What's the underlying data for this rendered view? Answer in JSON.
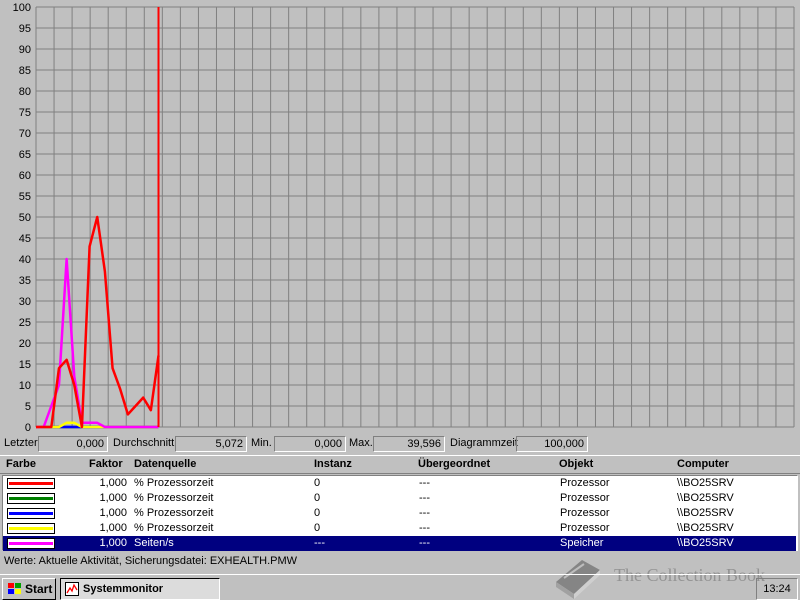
{
  "app": {
    "window_title": "Systemmonitor"
  },
  "chart_data": {
    "type": "line",
    "yticks": [
      "100",
      "95",
      "90",
      "85",
      "80",
      "75",
      "70",
      "65",
      "60",
      "55",
      "50",
      "45",
      "40",
      "35",
      "30",
      "25",
      "20",
      "15",
      "10",
      "5",
      "0"
    ],
    "ylim": [
      0,
      100
    ],
    "x_samples": 100,
    "cursor_sample": 16,
    "series": [
      {
        "color": "#ff0000",
        "values": [
          0,
          0,
          0,
          14,
          16,
          10,
          0,
          43,
          50,
          37,
          14,
          9,
          3,
          5,
          7,
          4,
          17
        ]
      },
      {
        "color": "#ff00ff",
        "values": [
          0,
          0,
          5,
          10,
          40,
          12,
          1,
          1,
          1,
          0,
          0,
          0,
          0,
          0,
          0,
          0,
          0
        ]
      },
      {
        "color": "#ffff00",
        "values": [
          0,
          0,
          0,
          0,
          1,
          1,
          0,
          0,
          0,
          0,
          0,
          0,
          0,
          0,
          0,
          0,
          0
        ]
      },
      {
        "color": "#0000ff",
        "values": [
          0,
          0,
          0,
          0,
          0,
          0,
          0,
          0,
          0,
          0,
          0,
          0,
          0,
          0,
          0,
          0,
          0
        ]
      },
      {
        "color": "#008000",
        "values": [
          0,
          0,
          0,
          0,
          0,
          0,
          0,
          0,
          0,
          0,
          0,
          0,
          0,
          0,
          0,
          0,
          0
        ]
      }
    ]
  },
  "stats": {
    "last_label": "Letzter",
    "last_value": "0,000",
    "avg_label": "Durchschnitt",
    "avg_value": "5,072",
    "min_label": "Min.",
    "min_value": "0,000",
    "max_label": "Max.",
    "max_value": "39,596",
    "time_label": "Diagrammzeit",
    "time_value": "100,000"
  },
  "legend": {
    "headers": {
      "color": "Farbe",
      "factor": "Faktor",
      "source": "Datenquelle",
      "instance": "Instanz",
      "parent": "Übergeordnet",
      "object": "Objekt",
      "computer": "Computer"
    },
    "rows": [
      {
        "color": "#ff0000",
        "factor": "1,000",
        "source": "% Prozessorzeit",
        "instance": "0",
        "parent": "---",
        "object": "Prozessor",
        "computer": "\\\\BO25SRV"
      },
      {
        "color": "#008000",
        "factor": "1,000",
        "source": "% Prozessorzeit",
        "instance": "0",
        "parent": "---",
        "object": "Prozessor",
        "computer": "\\\\BO25SRV"
      },
      {
        "color": "#0000ff",
        "factor": "1,000",
        "source": "% Prozessorzeit",
        "instance": "0",
        "parent": "---",
        "object": "Prozessor",
        "computer": "\\\\BO25SRV"
      },
      {
        "color": "#ffff00",
        "factor": "1,000",
        "source": "% Prozessorzeit",
        "instance": "0",
        "parent": "---",
        "object": "Prozessor",
        "computer": "\\\\BO25SRV"
      },
      {
        "color": "#ff00ff",
        "factor": "1,000",
        "source": "Seiten/s",
        "instance": "---",
        "parent": "---",
        "object": "Speicher",
        "computer": "\\\\BO25SRV"
      }
    ],
    "selected_row": 4
  },
  "status": {
    "text": "Werte: Aktuelle Aktivität, Sicherungsdatei: EXHEALTH.PMW"
  },
  "taskbar": {
    "start_label": "Start",
    "task_label": "Systemmonitor",
    "clock": "13:24"
  },
  "watermark": {
    "text": "The Collection Book"
  }
}
